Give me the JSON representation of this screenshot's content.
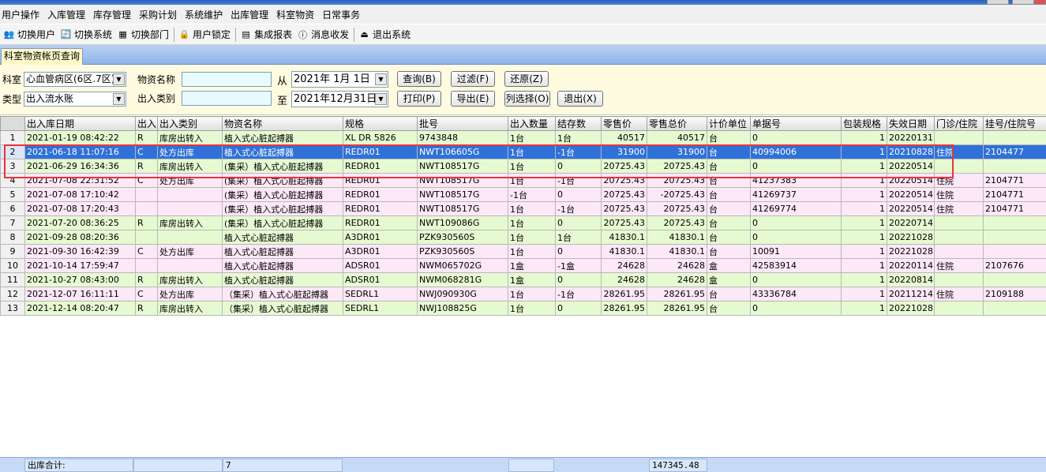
{
  "menu": [
    "用户操作",
    "入库管理",
    "库存管理",
    "采购计划",
    "系统维护",
    "出库管理",
    "科室物资",
    "日常事务"
  ],
  "toolbar": [
    {
      "label": "切换用户",
      "icon": "users-icon"
    },
    {
      "label": "切换系统",
      "icon": "switch-system-icon"
    },
    {
      "label": "切换部门",
      "icon": "department-icon"
    },
    {
      "label": "用户锁定",
      "icon": "user-lock-icon"
    },
    {
      "label": "集成报表",
      "icon": "report-icon"
    },
    {
      "label": "消息收发",
      "icon": "info-icon"
    },
    {
      "label": "退出系统",
      "icon": "exit-icon"
    }
  ],
  "tab": {
    "label": "科室物资帐页查询"
  },
  "filters": {
    "dept_label": "科室",
    "dept_value": "心血管病区(6区.7区)",
    "name_label": "物资名称",
    "from_label": "从",
    "from_date": "2021年 1月 1日",
    "type_label": "类型",
    "type_value": "出入流水账",
    "io_label": "出入类别",
    "to_label": "至",
    "to_date": "2021年12月31日",
    "btn_query": "查询(B)",
    "btn_filter": "过滤(F)",
    "btn_restore": "还原(Z)",
    "btn_print": "打印(P)",
    "btn_export": "导出(E)",
    "btn_columns": "列选择(O)",
    "btn_exit": "退出(X)"
  },
  "grid": {
    "headers": [
      "出入库日期",
      "出入",
      "出入类别",
      "物资名称",
      "规格",
      "批号",
      "出入数量",
      "结存数",
      "零售价",
      "零售总价",
      "计价单位",
      "单据号",
      "包装规格",
      "失效日期",
      "门诊/住院",
      "挂号/住院号"
    ],
    "rows": [
      {
        "n": "1",
        "c": [
          "2021-01-19 08:42:22",
          "R",
          "库房出转入",
          "植入式心脏起搏器",
          "XL DR 5826",
          "9743848",
          "1台",
          "1台",
          "40517",
          "40517",
          "台",
          "0",
          "1",
          "20220131",
          "",
          ""
        ],
        "style": "green"
      },
      {
        "n": "2",
        "c": [
          "2021-06-18 11:07:16",
          "C",
          "处方出库",
          "植入式心脏起搏器",
          "REDR01",
          "NWT106605G",
          "1台",
          "-1台",
          "31900",
          "31900",
          "台",
          "40994006",
          "1",
          "20210828",
          "住院",
          "2104477"
        ],
        "style": "sel"
      },
      {
        "n": "3",
        "c": [
          "2021-06-29 16:34:36",
          "R",
          "库房出转入",
          "(集采）植入式心脏起搏器",
          "REDR01",
          "NWT108517G",
          "1台",
          "0",
          "20725.43",
          "20725.43",
          "台",
          "0",
          "1",
          "20220514",
          "",
          ""
        ],
        "style": "green"
      },
      {
        "n": "4",
        "c": [
          "2021-07-08 22:31:52",
          "C",
          "处方出库",
          "(集采）植入式心脏起搏器",
          "REDR01",
          "NWT108517G",
          "1台",
          "-1台",
          "20725.43",
          "20725.43",
          "台",
          "41237383",
          "1",
          "20220514",
          "住院",
          "2104771"
        ],
        "style": "pink"
      },
      {
        "n": "5",
        "c": [
          "2021-07-08 17:10:42",
          "",
          "",
          "(集采）植入式心脏起搏器",
          "REDR01",
          "NWT108517G",
          "-1台",
          "0",
          "20725.43",
          "-20725.43",
          "台",
          "41269737",
          "1",
          "20220514",
          "住院",
          "2104771"
        ],
        "style": "pink"
      },
      {
        "n": "6",
        "c": [
          "2021-07-08 17:20:43",
          "",
          "",
          "(集采）植入式心脏起搏器",
          "REDR01",
          "NWT108517G",
          "1台",
          "-1台",
          "20725.43",
          "20725.43",
          "台",
          "41269774",
          "1",
          "20220514",
          "住院",
          "2104771"
        ],
        "style": "pink"
      },
      {
        "n": "7",
        "c": [
          "2021-07-20 08:36:25",
          "R",
          "库房出转入",
          "(集采）植入式心脏起搏器",
          "REDR01",
          "NWT109086G",
          "1台",
          "0",
          "20725.43",
          "20725.43",
          "台",
          "0",
          "1",
          "20220714",
          "",
          ""
        ],
        "style": "green"
      },
      {
        "n": "8",
        "c": [
          "2021-09-28 08:20:36",
          "",
          "",
          "植入式心脏起搏器",
          "A3DR01",
          "PZK930560S",
          "1台",
          "1台",
          "41830.1",
          "41830.1",
          "台",
          "0",
          "1",
          "20221028",
          "",
          ""
        ],
        "style": "green"
      },
      {
        "n": "9",
        "c": [
          "2021-09-30 16:42:39",
          "C",
          "处方出库",
          "植入式心脏起搏器",
          "A3DR01",
          "PZK930560S",
          "1台",
          "0",
          "41830.1",
          "41830.1",
          "台",
          "10091",
          "1",
          "20221028",
          "",
          ""
        ],
        "style": "pink"
      },
      {
        "n": "10",
        "c": [
          "2021-10-14 17:59:47",
          "",
          "",
          "植入式心脏起搏器",
          "ADSR01",
          "NWM065702G",
          "1盒",
          "-1盒",
          "24628",
          "24628",
          "盒",
          "42583914",
          "1",
          "20220114",
          "住院",
          "2107676"
        ],
        "style": "pink"
      },
      {
        "n": "11",
        "c": [
          "2021-10-27 08:43:00",
          "R",
          "库房出转入",
          "植入式心脏起搏器",
          "ADSR01",
          "NWM068281G",
          "1盒",
          "0",
          "24628",
          "24628",
          "盒",
          "0",
          "1",
          "20220814",
          "",
          ""
        ],
        "style": "green"
      },
      {
        "n": "12",
        "c": [
          "2021-12-07 16:11:11",
          "C",
          "处方出库",
          "（集采）植入式心脏起搏器",
          "SEDRL1",
          "NWJ090930G",
          "1台",
          "-1台",
          "28261.95",
          "28261.95",
          "台",
          "43336784",
          "1",
          "20211214",
          "住院",
          "2109188"
        ],
        "style": "pink"
      },
      {
        "n": "13",
        "c": [
          "2021-12-14 08:20:47",
          "R",
          "库房出转入",
          "（集采）植入式心脏起搏器",
          "SEDRL1",
          "NWJ108825G",
          "1台",
          "0",
          "28261.95",
          "28261.95",
          "台",
          "0",
          "1",
          "20221028",
          "",
          ""
        ],
        "style": "green"
      }
    ]
  },
  "footer": {
    "label": "出库合计:",
    "count": "7",
    "total": "147345.48"
  }
}
